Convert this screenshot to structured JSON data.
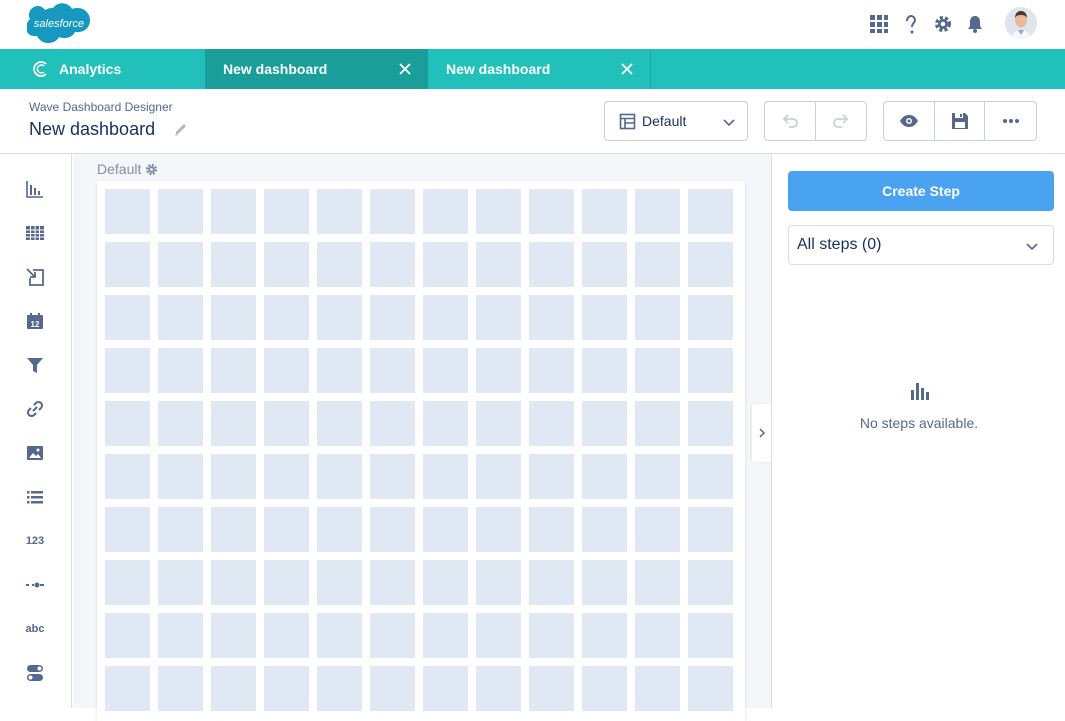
{
  "brand": {
    "logo_text": "salesforce",
    "logo_color": "#1798c1"
  },
  "header": {
    "icons": [
      "app-launcher-icon",
      "help-icon",
      "setup-gear-icon",
      "notifications-bell-icon"
    ]
  },
  "tabbar": {
    "app_name": "Analytics",
    "tabs": [
      {
        "label": "New dashboard",
        "active": true
      },
      {
        "label": "New dashboard",
        "active": false
      }
    ],
    "color": "#22c0bb",
    "active_color": "#199e9a"
  },
  "page": {
    "subtitle": "Wave Dashboard Designer",
    "title": "New dashboard",
    "layout_select": "Default"
  },
  "toolbar_left": {
    "items": [
      {
        "name": "chart-widget-icon"
      },
      {
        "name": "table-widget-icon"
      },
      {
        "name": "compare-table-widget-icon"
      },
      {
        "name": "date-widget-icon"
      },
      {
        "name": "filter-widget-icon"
      },
      {
        "name": "link-widget-icon"
      },
      {
        "name": "image-widget-icon"
      },
      {
        "name": "list-widget-icon"
      },
      {
        "name": "number-widget-icon",
        "text": "123"
      },
      {
        "name": "range-widget-icon"
      },
      {
        "name": "text-widget-icon",
        "text": "abc"
      },
      {
        "name": "toggle-widget-icon"
      }
    ]
  },
  "canvas": {
    "label": "Default"
  },
  "right_panel": {
    "create_step": "Create Step",
    "steps_select": "All steps (0)",
    "empty_message": "No steps available."
  }
}
